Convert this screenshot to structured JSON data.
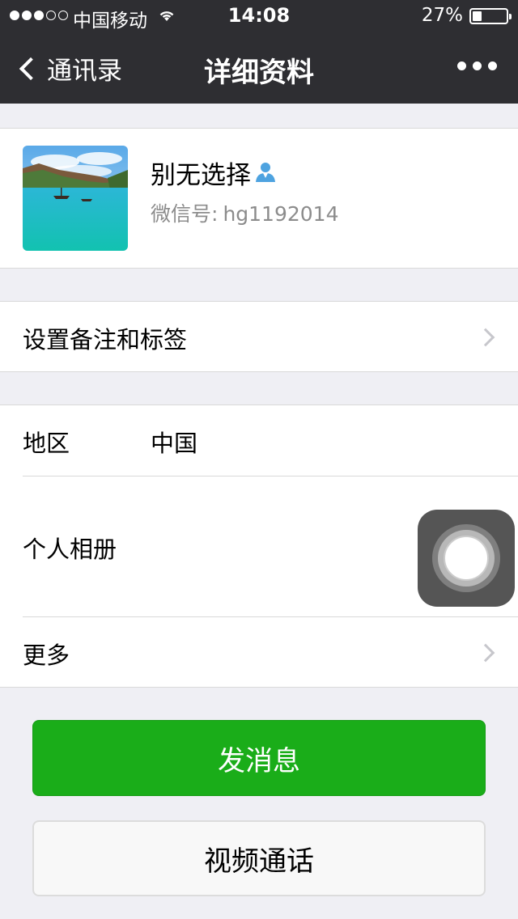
{
  "status_bar": {
    "carrier": "中国移动",
    "time": "14:08",
    "battery_percent": "27%",
    "battery_level": 0.27,
    "signal_bars_filled": 3,
    "signal_bars_total": 5
  },
  "nav": {
    "back_label": "通讯录",
    "title": "详细资料",
    "more_icon": "more-icon"
  },
  "profile": {
    "name": "别无选择",
    "wechat_id_label": "微信号:",
    "wechat_id": "hg1192014",
    "badge_icon": "user-icon"
  },
  "remark": {
    "label": "设置备注和标签"
  },
  "info": {
    "region_label": "地区",
    "region_value": "中国",
    "album_label": "个人相册",
    "more_label": "更多"
  },
  "actions": {
    "send_message": "发消息",
    "video_call": "视频通话"
  },
  "colors": {
    "primary_green": "#1aad19",
    "navbar_bg": "#2e2e32",
    "page_bg": "#efeff4",
    "badge_blue": "#4ea3e0"
  }
}
